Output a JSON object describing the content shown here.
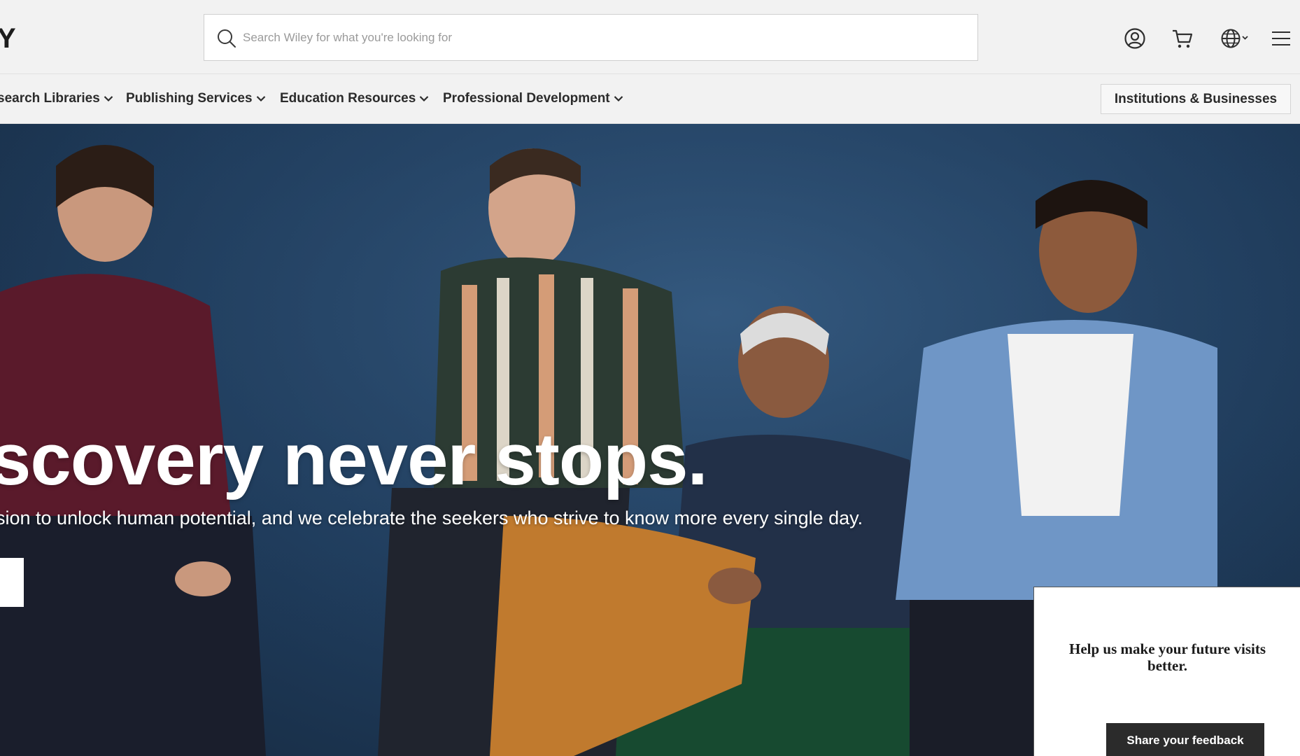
{
  "header": {
    "logo_fragment": "Y",
    "search": {
      "placeholder": "Search Wiley for what you're looking for",
      "value": ""
    },
    "icons": [
      "account-icon",
      "cart-icon",
      "globe-icon",
      "menu-icon"
    ]
  },
  "nav": {
    "items": [
      {
        "label": "search Libraries"
      },
      {
        "label": "Publishing Services"
      },
      {
        "label": "Education Resources"
      },
      {
        "label": "Professional Development"
      }
    ],
    "institutions_button": "Institutions & Businesses"
  },
  "hero": {
    "title": "scovery never stops.",
    "subtitle": "sion to unlock human potential, and we celebrate the seekers who strive to know more every single day."
  },
  "feedback": {
    "text": "Help us make your future visits better.",
    "button": "Share your feedback"
  },
  "colors": {
    "header_bg": "#f2f2f2",
    "hero_bg": "#1f3c5c",
    "button_dark": "#2b2b2b"
  }
}
